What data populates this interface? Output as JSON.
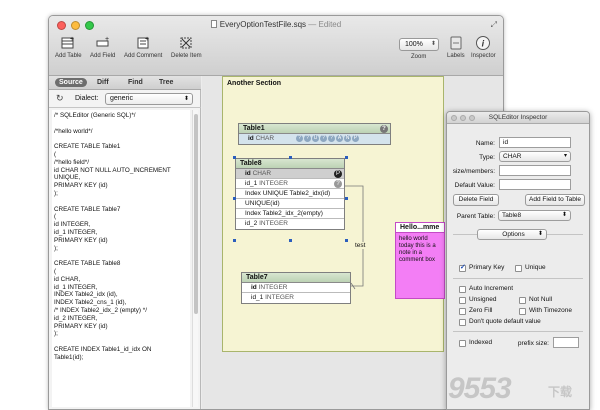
{
  "window": {
    "title": "EveryOptionTestFile.sqs",
    "status": "Edited",
    "separator": "—",
    "traffic_lights": [
      "#fc605c",
      "#fdbc40",
      "#34c84a"
    ]
  },
  "toolbar": {
    "add_table": "Add Table",
    "add_field": "Add Field",
    "add_comment": "Add Comment",
    "delete_item": "Delete Item",
    "zoom_value": "100%",
    "zoom_label": "Zoom",
    "labels_label": "Labels",
    "inspector_label": "Inspector"
  },
  "left_tabs": [
    "Source",
    "Diff",
    "Find",
    "Tree"
  ],
  "dialect": {
    "label": "Dialect:",
    "value": "generic"
  },
  "sql_lines": [
    "/* SQLEditor (Generic SQL)*/",
    "",
    "/*hello world*/",
    "",
    "CREATE TABLE Table1",
    "(",
    "/*hello field*/",
    "id CHAR NOT NULL AUTO_INCREMENT",
    "UNIQUE,",
    "PRIMARY KEY (id)",
    ");",
    "",
    "CREATE TABLE Table7",
    "(",
    "id INTEGER,",
    "id_1 INTEGER,",
    "PRIMARY KEY (id)",
    ");",
    "",
    "CREATE TABLE Table8",
    "(",
    "id CHAR,",
    "id_1 INTEGER,",
    "INDEX Table2_idx (id),",
    "INDEX Table2_cns_1 (id),",
    "/* INDEX Table2_idx_2 (empty) */",
    "id_2 INTEGER,",
    "PRIMARY KEY (id)",
    ");",
    "",
    "CREATE INDEX Table1_id_idx ON",
    "Table1(id);"
  ],
  "canvas": {
    "section_title": "Another Section",
    "table1": {
      "name": "Table1",
      "row_name": "id",
      "row_type": "CHAR",
      "badges": [
        "?",
        "?",
        "U",
        "?",
        "?",
        "A",
        "N",
        "P"
      ],
      "help": "?"
    },
    "table8": {
      "name": "Table8",
      "help": "?",
      "rows": [
        {
          "name": "id",
          "type": "CHAR",
          "badge": "P"
        },
        {
          "name": "id_1",
          "type": "INTEGER",
          "badge": "?"
        },
        {
          "text": "Index UNIQUE Table2_idx(id)"
        },
        {
          "text": "UNIQUE(id)"
        },
        {
          "text": "Index Table2_idx_2(empty)"
        },
        {
          "name": "id_2",
          "type": "INTEGER"
        }
      ]
    },
    "table7": {
      "name": "Table7",
      "rows": [
        {
          "name": "id",
          "type": "INTEGER"
        },
        {
          "name": "id_1",
          "type": "INTEGER"
        }
      ]
    },
    "connector_label": "test",
    "note": {
      "title": "Hello...mme",
      "body": "hello world today this is a note in a comment box"
    }
  },
  "inspector": {
    "title": "SQLEditor Inspector",
    "name_label": "Name:",
    "name_value": "id",
    "type_label": "Type:",
    "type_value": "CHAR",
    "size_label": "size/members:",
    "size_value": "",
    "default_label": "Default Value:",
    "default_value": "",
    "delete_field": "Delete Field",
    "add_field_to_table": "Add Field to Table",
    "parent_label": "Parent Table:",
    "parent_value": "Table8",
    "options_label": "Options",
    "primary_key": "Primary Key",
    "unique": "Unique",
    "auto_increment": "Auto Increment",
    "unsigned": "Unsigned",
    "not_null": "Not Null",
    "zero_fill": "Zero Fill",
    "with_timezone": "With Timezone",
    "dont_quote": "Don't quote default value",
    "indexed": "Indexed",
    "prefix_size": "prefix size:",
    "checks": {
      "primary_key": true,
      "unique": false,
      "auto_increment": false,
      "unsigned": false,
      "not_null": false,
      "zero_fill": false,
      "with_timezone": false,
      "dont_quote": false,
      "indexed": false
    }
  },
  "watermark": {
    "main": "9553",
    "sub": "下载"
  }
}
